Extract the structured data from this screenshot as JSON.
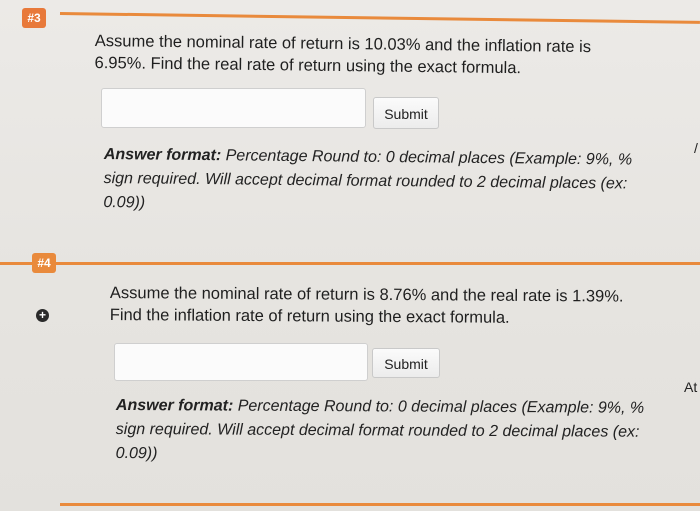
{
  "colors": {
    "accent": "#e98a3c",
    "background": "#e7e5e2"
  },
  "questions": [
    {
      "badge": "#3",
      "text": "Assume the nominal rate of return is 10.03% and the inflation rate is 6.95%. Find the real rate of return using the exact formula.",
      "input_value": "",
      "submit_label": "Submit",
      "format_label": "Answer format:",
      "format_text": " Percentage Round to: 0 decimal places (Example: 9%, % sign required. Will accept decimal format rounded to 2 decimal places (ex: 0.09))"
    },
    {
      "badge": "#4",
      "text": "Assume the nominal rate of return is 8.76% and the real rate is 1.39%. Find the inflation rate of return using the exact formula.",
      "input_value": "",
      "submit_label": "Submit",
      "format_label": "Answer format:",
      "format_text": " Percentage Round to: 0 decimal places (Example: 9%, % sign required. Will accept decimal format rounded to 2 decimal places (ex: 0.09))"
    }
  ],
  "edge_text": "At",
  "icons": {
    "add": "plus-circle-icon"
  }
}
